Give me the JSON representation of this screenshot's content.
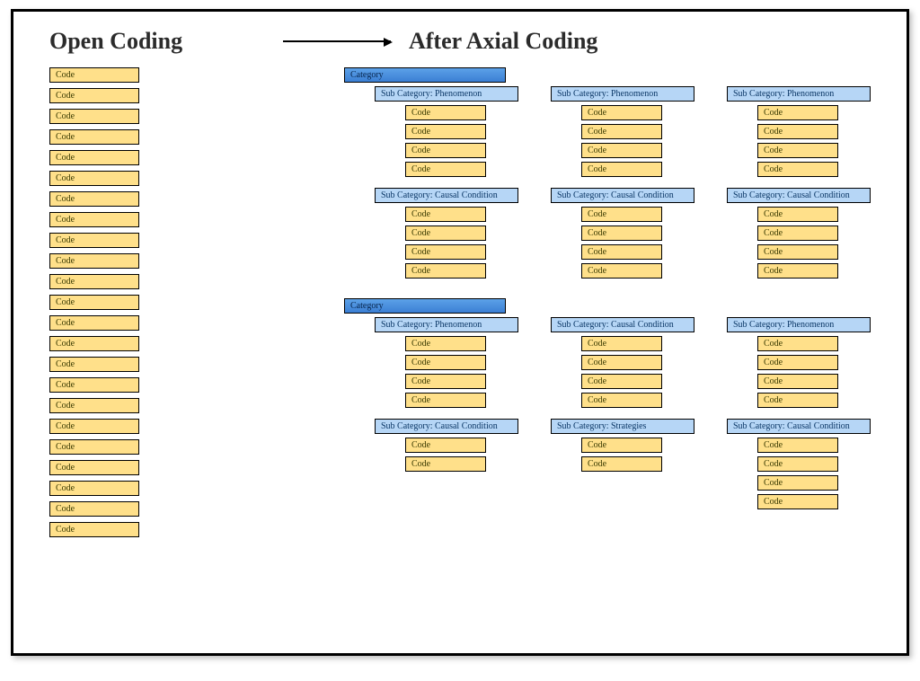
{
  "titles": {
    "open": "Open Coding",
    "axial": "After Axial Coding"
  },
  "labels": {
    "code": "Code",
    "category": "Category",
    "sub_phenomenon": "Sub Category: Phenomenon",
    "sub_causal": "Sub Category: Causal Condition",
    "sub_strategies": "Sub Category: Strategies"
  },
  "open_codes_count": 23,
  "axial": [
    {
      "category": "Category",
      "row1": [
        {
          "sub": "sub_phenomenon",
          "codes": 4
        },
        {
          "sub": "sub_phenomenon",
          "codes": 4
        },
        {
          "sub": "sub_phenomenon",
          "codes": 4
        }
      ],
      "row2": [
        {
          "sub": "sub_causal",
          "codes": 4
        },
        {
          "sub": "sub_causal",
          "codes": 4
        },
        {
          "sub": "sub_causal",
          "codes": 4
        }
      ]
    },
    {
      "category": "Category",
      "row1": [
        {
          "sub": "sub_phenomenon",
          "codes": 4
        },
        {
          "sub": "sub_causal",
          "codes": 4
        },
        {
          "sub": "sub_phenomenon",
          "codes": 4
        }
      ],
      "row2": [
        {
          "sub": "sub_causal",
          "codes": 2
        },
        {
          "sub": "sub_strategies",
          "codes": 2
        },
        {
          "sub": "sub_causal",
          "codes": 4
        }
      ]
    }
  ]
}
